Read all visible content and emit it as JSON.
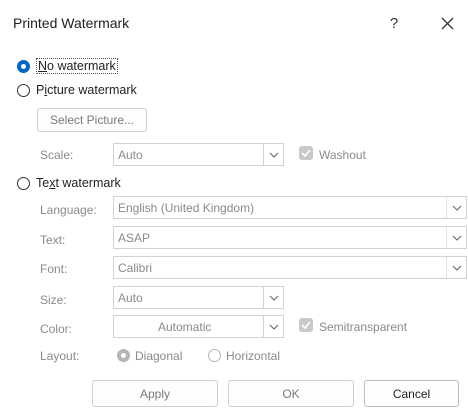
{
  "dialog": {
    "title": "Printed Watermark",
    "help_label": "?"
  },
  "options": {
    "no_watermark": {
      "hotkey": "N",
      "rest": "o watermark",
      "selected": true
    },
    "picture_watermark": {
      "pre": "P",
      "hotkey": "i",
      "rest": "cture watermark",
      "selected": false
    },
    "text_watermark": {
      "pre": "Te",
      "hotkey": "x",
      "rest": "t watermark",
      "selected": false
    }
  },
  "picture": {
    "select_button": "Select Picture...",
    "scale_label": "Scale:",
    "scale_value": "Auto",
    "washout_label": "Washout",
    "washout_checked": true
  },
  "text": {
    "language_label": "Language:",
    "language_value": "English (United Kingdom)",
    "text_label": "Text:",
    "text_value": "ASAP",
    "font_label": "Font:",
    "font_value": "Calibri",
    "size_label": "Size:",
    "size_value": "Auto",
    "color_label": "Color:",
    "color_value": "Automatic",
    "semitransparent_label": "Semitransparent",
    "semitransparent_checked": true,
    "layout_label": "Layout:",
    "layout_options": [
      "Diagonal",
      "Horizontal"
    ],
    "layout_selected": "Diagonal"
  },
  "footer": {
    "apply": "Apply",
    "ok": "OK",
    "cancel": "Cancel"
  },
  "colors": {
    "accent": "#0067c0",
    "disabled_text": "#8a8a8a"
  }
}
